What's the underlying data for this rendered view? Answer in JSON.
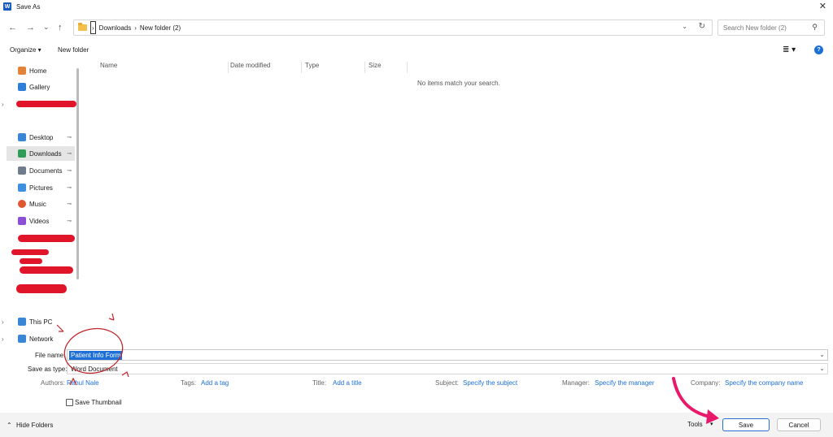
{
  "window": {
    "title": "Save As",
    "app_icon": "word-icon",
    "close_glyph": "✕"
  },
  "nav": {
    "back": "←",
    "forward": "→",
    "recent": "⌄",
    "up": "↑",
    "breadcrumb": [
      "Downloads",
      "New folder (2)"
    ],
    "breadcrumb_sep": "›",
    "search_placeholder": "Search New folder (2)"
  },
  "toolbar": {
    "organize": "Organize ▾",
    "new_folder": "New folder",
    "view": "≣ ▾",
    "help": "?"
  },
  "sidebar": {
    "items": [
      {
        "label": "Home",
        "icon": "home-icon",
        "color": "#e3833a"
      },
      {
        "label": "Gallery",
        "icon": "gallery-icon",
        "color": "#2f7fd8"
      },
      {
        "label": "Desktop",
        "icon": "desktop-icon",
        "color": "#3a86d6"
      },
      {
        "label": "Downloads",
        "icon": "download-icon",
        "color": "#2f9d57"
      },
      {
        "label": "Documents",
        "icon": "documents-icon",
        "color": "#6f7c8c"
      },
      {
        "label": "Pictures",
        "icon": "pictures-icon",
        "color": "#3d8fe0"
      },
      {
        "label": "Music",
        "icon": "music-icon",
        "color": "#e0562f"
      },
      {
        "label": "Videos",
        "icon": "videos-icon",
        "color": "#8a4fd6"
      },
      {
        "label": "This PC",
        "icon": "pc-icon",
        "color": "#3a86d6"
      },
      {
        "label": "Network",
        "icon": "network-icon",
        "color": "#3a86d6"
      }
    ],
    "selected": "Downloads",
    "pin": "📌",
    "hide_folders": "Hide Folders"
  },
  "content": {
    "columns": [
      "Name",
      "Date modified",
      "Type",
      "Size"
    ],
    "empty_message": "No items match your search."
  },
  "form": {
    "file_name_label": "File name:",
    "file_name_value": "Patient Info Form",
    "save_type_label": "Save as type:",
    "save_type_value": "Word Document"
  },
  "metadata": [
    {
      "label": "Authors:",
      "value": "Rahul Nale"
    },
    {
      "label": "Tags:",
      "value": "Add a tag"
    },
    {
      "label": "Title:",
      "value": "Add a title"
    },
    {
      "label": "Subject:",
      "value": "Specify the subject"
    },
    {
      "label": "Manager:",
      "value": "Specify the manager"
    },
    {
      "label": "Company:",
      "value": "Specify the company name"
    }
  ],
  "thumbnail": {
    "label": "Save Thumbnail",
    "checked": false
  },
  "footer": {
    "tools": "Tools",
    "save": "Save",
    "cancel": "Cancel"
  },
  "colors": {
    "accent": "#1d6fd8",
    "annotation_red": "#c0272d",
    "arrow_pink": "#e8196a",
    "redaction": "#e0152a"
  }
}
